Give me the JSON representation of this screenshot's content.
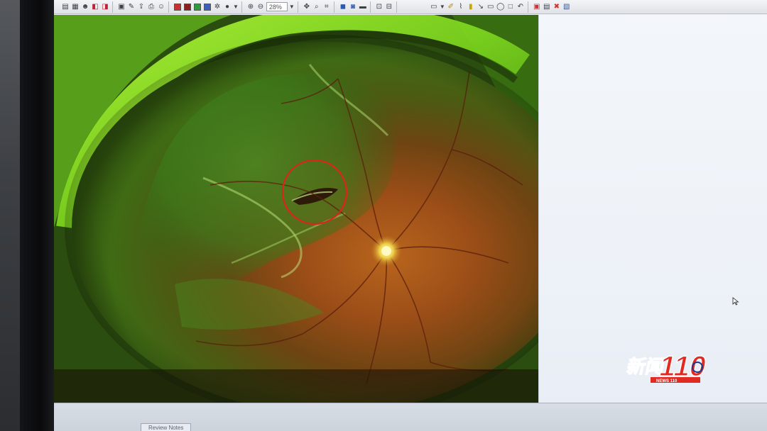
{
  "toolbar": {
    "zoom_value": "28%",
    "groups": [
      [
        "open-folder-icon",
        "grid-icon",
        "patient-icon",
        "compare-icon"
      ],
      [
        "save-icon",
        "sign-icon",
        "export-icon",
        "print-icon",
        "share-icon"
      ],
      [
        "red-filter-icon",
        "green-filter-icon",
        "blue-filter-icon",
        "settings-icon",
        "pin-icon"
      ],
      [
        "zoom-in-icon",
        "zoom-field",
        "fit-icon",
        "search-icon",
        "crop-icon"
      ],
      [
        "layout-icon",
        "overlay-icon",
        "rotate-icon"
      ],
      [
        "lock-icon",
        "measure-icon"
      ],
      [
        "new-note-icon",
        "annotate-icons"
      ],
      [
        "delete-icons"
      ]
    ]
  },
  "viewer": {
    "image_kind": "ultra-widefield-fundus",
    "annotation_color": "#d9261c"
  },
  "bottom_tabs": {
    "review_notes": "Review Notes"
  },
  "watermark": {
    "text_main": "新闻110",
    "text_sub": "NEWS 110",
    "color": "#e02a22"
  }
}
